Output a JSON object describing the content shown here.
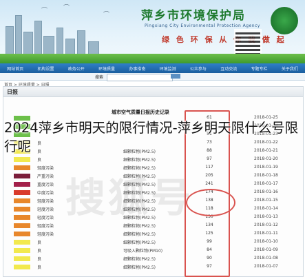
{
  "header": {
    "site_title": "萍乡市环境保护局",
    "site_subtitle": "Pingxiang City Environmental Protection Agency",
    "slogan": "绿 色 环 保 从 你 我 做 起"
  },
  "nav": {
    "items": [
      "网站首页",
      "机构设置",
      "政务公开",
      "环境质量",
      "办事指南",
      "环境监测",
      "公众参与",
      "互动交流",
      "专题专栏",
      "关于我们"
    ]
  },
  "search": {
    "label": "搜索",
    "placeholder": ""
  },
  "breadcrumb": "首页 > 环境质量 > 日报",
  "panel": {
    "title": "日报"
  },
  "table": {
    "title": "城市空气质量日报历史记录"
  },
  "rows": [
    {
      "color": "#6cc04a",
      "a": "",
      "b": "",
      "aqi": "61",
      "date": "2018-01-25"
    },
    {
      "color": "#6cc04a",
      "a": "",
      "b": "",
      "aqi": "57",
      "date": "2018-01-24"
    },
    {
      "color": "#6cc04a",
      "a": "",
      "b": "",
      "aqi": "51",
      "date": "2018-01-23"
    },
    {
      "color": "#f2e94e",
      "a": "良",
      "b": "",
      "aqi": "73",
      "date": "2018-01-22"
    },
    {
      "color": "#f2e94e",
      "a": "良",
      "b": "细颗粒物(PM2.5)",
      "aqi": "88",
      "date": "2018-01-21"
    },
    {
      "color": "#f2e94e",
      "a": "良",
      "b": "细颗粒物(PM2.5)",
      "aqi": "97",
      "date": "2018-01-20"
    },
    {
      "color": "#e8872b",
      "a": "轻度污染",
      "b": "细颗粒物(PM2.5)",
      "aqi": "117",
      "date": "2018-01-19"
    },
    {
      "color": "#7b1d3a",
      "a": "严重污染",
      "b": "细颗粒物(PM2.5)",
      "aqi": "205",
      "date": "2018-01-18"
    },
    {
      "color": "#a3204a",
      "a": "重度污染",
      "b": "细颗粒物(PM2.5)",
      "aqi": "241",
      "date": "2018-01-17"
    },
    {
      "color": "#d93a2b",
      "a": "中度污染",
      "b": "细颗粒物(PM2.5)",
      "aqi": "174",
      "date": "2018-01-16"
    },
    {
      "color": "#e8872b",
      "a": "轻度污染",
      "b": "细颗粒物(PM2.5)",
      "aqi": "138",
      "date": "2018-01-15"
    },
    {
      "color": "#e8872b",
      "a": "轻度污染",
      "b": "细颗粒物(PM2.5)",
      "aqi": "118",
      "date": "2018-01-14"
    },
    {
      "color": "#e8872b",
      "a": "轻度污染",
      "b": "细颗粒物(PM2.5)",
      "aqi": "130",
      "date": "2018-01-13"
    },
    {
      "color": "#e8872b",
      "a": "轻度污染",
      "b": "细颗粒物(PM2.5)",
      "aqi": "134",
      "date": "2018-01-12"
    },
    {
      "color": "#e8872b",
      "a": "轻度污染",
      "b": "细颗粒物(PM2.5)",
      "aqi": "125",
      "date": "2018-01-11"
    },
    {
      "color": "#f2e94e",
      "a": "良",
      "b": "细颗粒物(PM2.5)",
      "aqi": "99",
      "date": "2018-01-10"
    },
    {
      "color": "#f2e94e",
      "a": "良",
      "b": "可吸入颗粒物(PM10)",
      "aqi": "84",
      "date": "2018-01-09"
    },
    {
      "color": "#f2e94e",
      "a": "良",
      "b": "细颗粒物(PM2.5)",
      "aqi": "90",
      "date": "2018-01-08"
    },
    {
      "color": "#f2e94e",
      "a": "良",
      "b": "细颗粒物(PM2.5)",
      "aqi": "97",
      "date": "2018-01-07"
    }
  ],
  "watermark": "搜狐号",
  "caption": "2024萍乡市明天的限行情况-萍乡明天限什么号限行呢"
}
